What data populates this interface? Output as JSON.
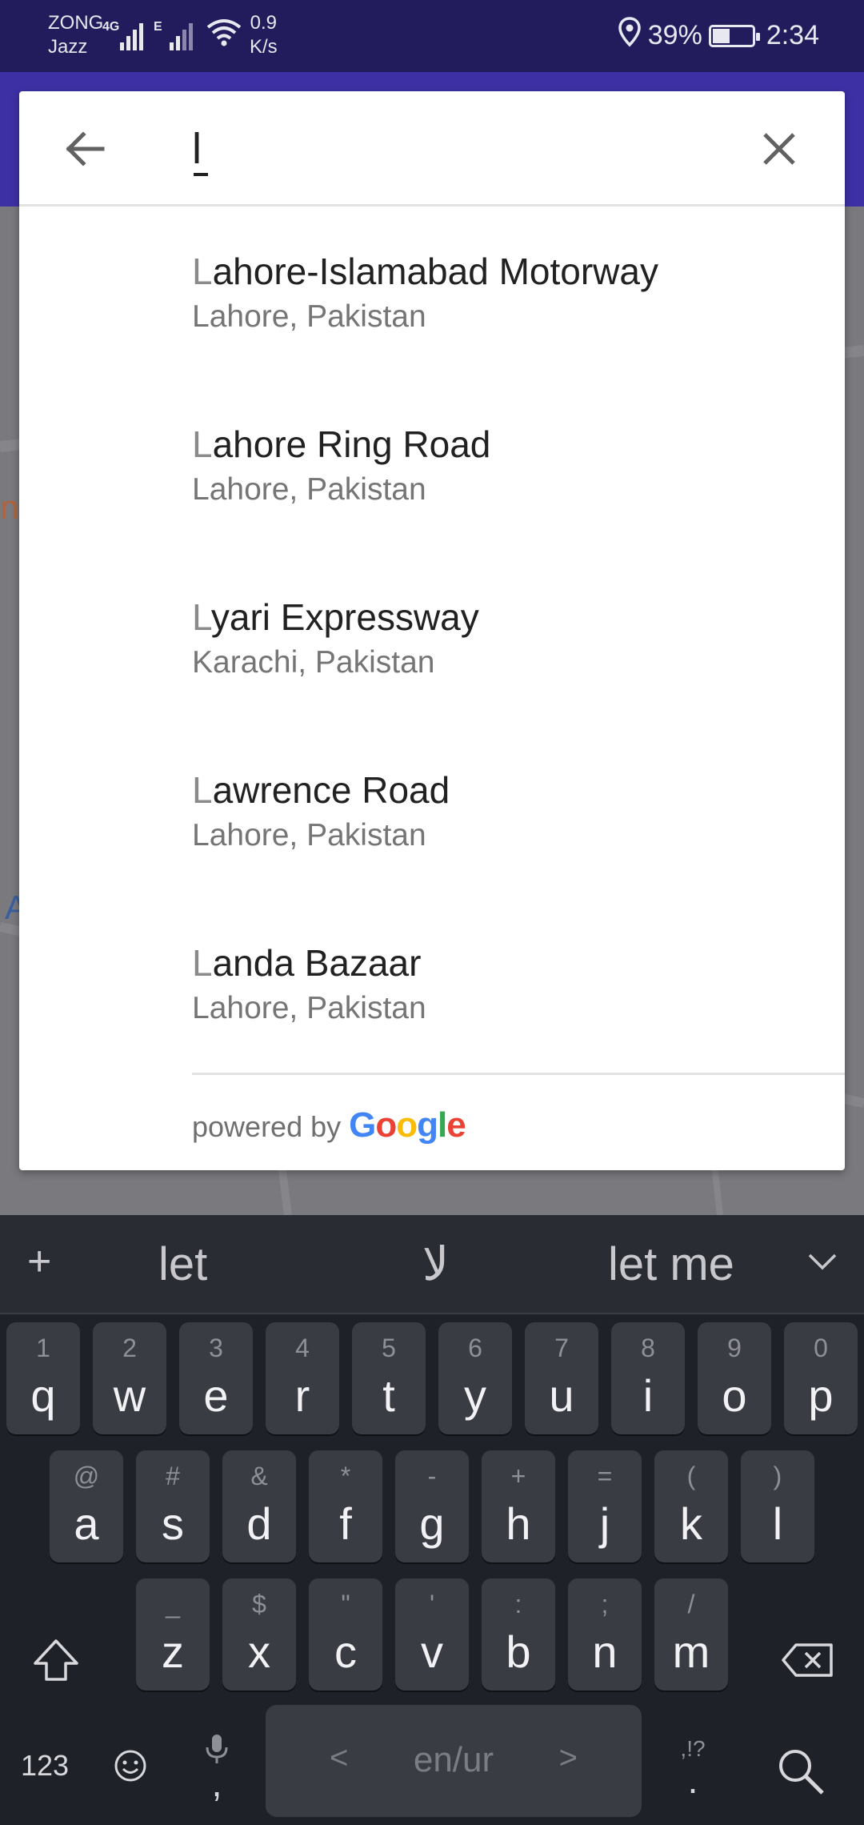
{
  "status_bar": {
    "carrier_1": "ZONG",
    "carrier_2": "Jazz",
    "net_4g": "4G",
    "net_e": "E",
    "speed_value": "0.9",
    "speed_unit": "K/s",
    "battery": "39%",
    "time": "2:34"
  },
  "map": {
    "fragment_1": "no",
    "fragment_2": "A"
  },
  "search": {
    "query": "l",
    "back_icon": "arrow-back-icon",
    "clear_icon": "close-icon"
  },
  "results": [
    {
      "match": "L",
      "rest": "ahore-Islamabad Motorway",
      "subtitle": "Lahore, Pakistan"
    },
    {
      "match": "L",
      "rest": "ahore Ring Road",
      "subtitle": "Lahore, Pakistan"
    },
    {
      "match": "L",
      "rest": "yari Expressway",
      "subtitle": "Karachi, Pakistan"
    },
    {
      "match": "L",
      "rest": "awrence Road",
      "subtitle": "Lahore, Pakistan"
    },
    {
      "match": "L",
      "rest": "anda Bazaar",
      "subtitle": "Lahore, Pakistan"
    }
  ],
  "footer": {
    "powered_by": "powered by",
    "brand": "Google",
    "brand_colors": [
      "#4285F4",
      "#EA4335",
      "#FBBC05",
      "#4285F4",
      "#34A853",
      "#EA4335"
    ]
  },
  "keyboard": {
    "suggestions": [
      "let",
      "لا",
      "let me"
    ],
    "row1": [
      {
        "main": "q",
        "sym": "1"
      },
      {
        "main": "w",
        "sym": "2"
      },
      {
        "main": "e",
        "sym": "3"
      },
      {
        "main": "r",
        "sym": "4"
      },
      {
        "main": "t",
        "sym": "5"
      },
      {
        "main": "y",
        "sym": "6"
      },
      {
        "main": "u",
        "sym": "7"
      },
      {
        "main": "i",
        "sym": "8"
      },
      {
        "main": "o",
        "sym": "9"
      },
      {
        "main": "p",
        "sym": "0"
      }
    ],
    "row2": [
      {
        "main": "a",
        "sym": "@"
      },
      {
        "main": "s",
        "sym": "#"
      },
      {
        "main": "d",
        "sym": "&"
      },
      {
        "main": "f",
        "sym": "*"
      },
      {
        "main": "g",
        "sym": "-"
      },
      {
        "main": "h",
        "sym": "+"
      },
      {
        "main": "j",
        "sym": "="
      },
      {
        "main": "k",
        "sym": "("
      },
      {
        "main": "l",
        "sym": ")"
      }
    ],
    "row3": [
      {
        "main": "z",
        "sym": "_"
      },
      {
        "main": "x",
        "sym": "$"
      },
      {
        "main": "c",
        "sym": "\""
      },
      {
        "main": "v",
        "sym": "'"
      },
      {
        "main": "b",
        "sym": ":"
      },
      {
        "main": "n",
        "sym": ";"
      },
      {
        "main": "m",
        "sym": "/"
      }
    ],
    "num_label": "123",
    "comma": ",",
    "space_label": "en/ur",
    "space_left": "<",
    "space_right": ">",
    "period": ".",
    "period_sym": ",!?",
    "accent_color": "#3d30a5"
  }
}
